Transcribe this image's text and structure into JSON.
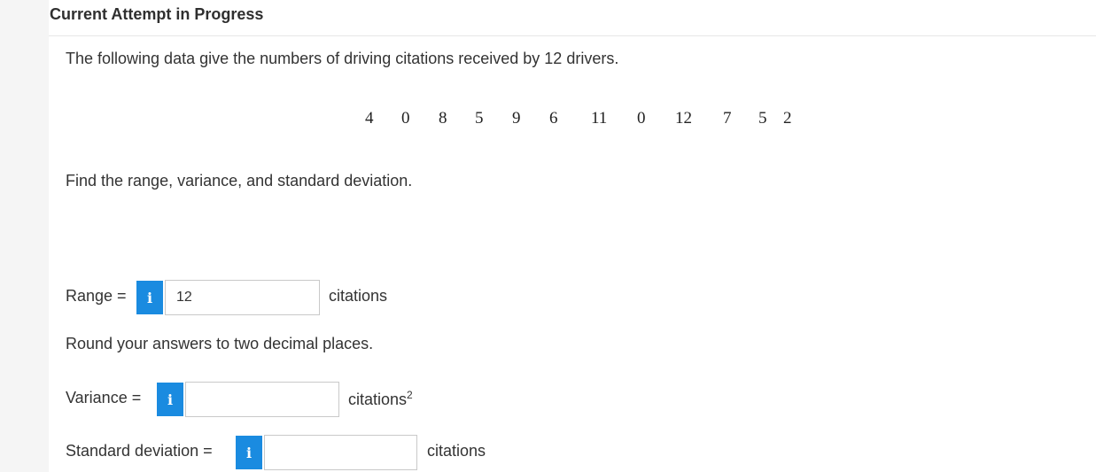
{
  "header": {
    "title": "Current Attempt in Progress"
  },
  "question": {
    "intro": "The following data give the numbers of driving citations received by 12 drivers.",
    "data_values": [
      "4",
      "0",
      "8",
      "5",
      "9",
      "6",
      "11",
      "0",
      "12",
      "7",
      "5",
      "2"
    ],
    "prompt": "Find the range, variance, and standard deviation.",
    "rounding_note": "Round your answers to two decimal places."
  },
  "answers": {
    "range": {
      "label": "Range =",
      "value": "12",
      "unit": "citations"
    },
    "variance": {
      "label": "Variance =",
      "value": "",
      "unit": "citations",
      "unit_sup": "2"
    },
    "std_dev": {
      "label": "Standard deviation =",
      "value": "",
      "unit": "citations"
    },
    "info_glyph": "i"
  },
  "colors": {
    "info_button": "#1a8be0",
    "gutter": "#f5f5f5"
  }
}
